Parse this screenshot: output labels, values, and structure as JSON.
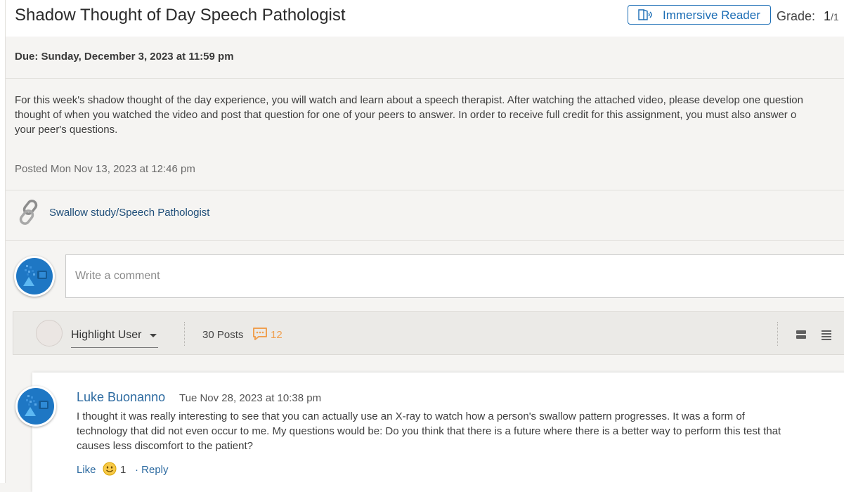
{
  "header": {
    "title": "Shadow Thought of Day Speech Pathologist",
    "immersive_reader_label": "Immersive Reader",
    "grade_label": "Grade:",
    "grade_numerator": "1",
    "grade_denominator": "/1"
  },
  "assignment": {
    "due": "Due: Sunday, December 3, 2023 at 11:59 pm",
    "description_lines": [
      "For this week's shadow thought of the day experience, you will watch and learn about a speech therapist. After watching the attached video, please develop one question",
      "thought of when you watched the video and post that question for one of your peers to answer. In order to receive full credit for this assignment, you must also answer o",
      "your peer's questions."
    ],
    "posted": "Posted Mon Nov 13, 2023 at 12:46 pm",
    "attachment_label": "Swallow study/Speech Pathologist"
  },
  "comment": {
    "placeholder": "Write a comment"
  },
  "toolbar": {
    "highlight_user_label": "Highlight User",
    "posts_count": "30 Posts",
    "unread_count": "12"
  },
  "post": {
    "author": "Luke Buonanno",
    "time": "Tue Nov 28, 2023 at 10:38 pm",
    "body_lines": [
      "I thought it was really interesting to see that you can actually use an X-ray to watch how a person's swallow pattern progresses. It was a form of",
      "technology that did not even occur to me. My questions would be: Do you think that there is a future where there is a better way to perform this test that",
      "causes less discomfort to the patient?"
    ],
    "like_label": "Like",
    "reaction_count": "1",
    "reply_label": "· Reply"
  },
  "colors": {
    "accent_blue": "#1b6db5",
    "link_blue": "#2c6aa0",
    "unread_orange": "#f0a050",
    "page_background": "#f5f4f2"
  },
  "icons": {
    "immersive_reader": "immersive-reader-icon",
    "attachment": "link-chain-icon",
    "avatar": "user-avatar-icon",
    "unread": "speech-bubble-icon",
    "view_cards": "card-view-icon",
    "view_list": "list-view-icon",
    "reaction": "smiley-emoji-icon"
  }
}
